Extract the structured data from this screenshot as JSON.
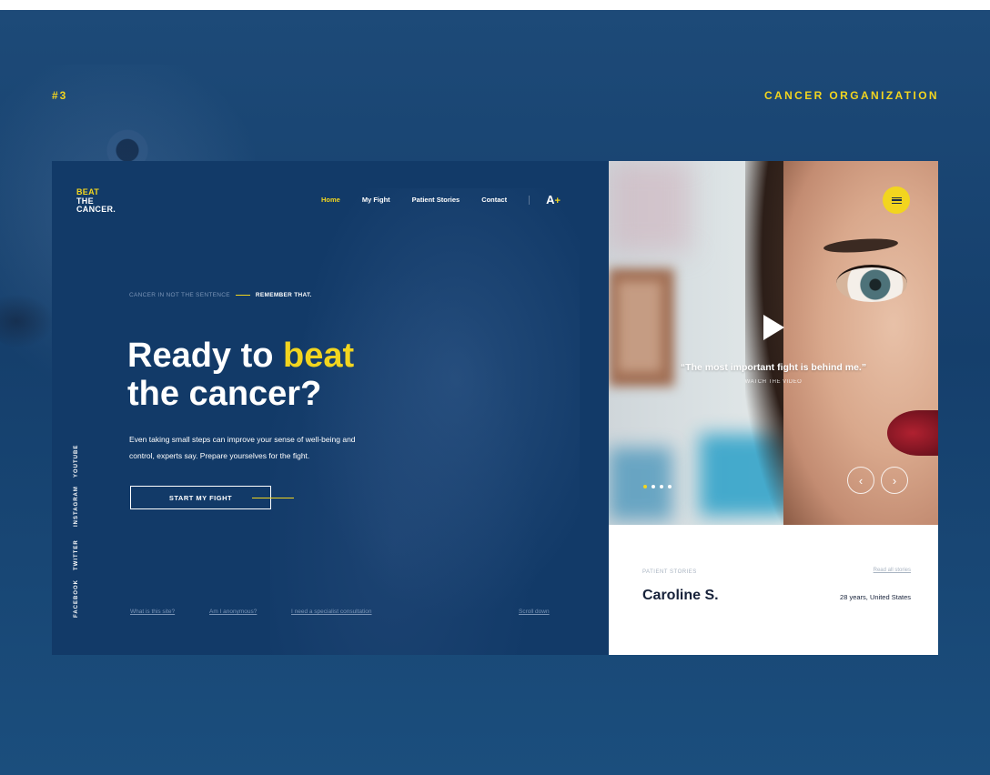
{
  "section": {
    "number": "#3",
    "title": "CANCER ORGANIZATION"
  },
  "logo": {
    "line1": "BEAT",
    "line2": "THE",
    "line3": "CANCER."
  },
  "nav": {
    "items": [
      {
        "label": "Home",
        "active": true
      },
      {
        "label": "My Fight",
        "active": false
      },
      {
        "label": "Patient Stories",
        "active": false
      },
      {
        "label": "Contact",
        "active": false
      }
    ],
    "font_size_letter": "A",
    "font_size_plus": "+"
  },
  "hero": {
    "tagline_muted": "CANCER IN NOT THE SENTENCE",
    "tagline_bold": "REMEMBER THAT.",
    "headline_part1": "Ready to",
    "headline_highlight": "beat",
    "headline_part2": "the cancer?",
    "lead": "Even taking small steps can improve your sense of well-being and control, experts say. Prepare yourselves for the fight.",
    "cta_label": "START MY FIGHT"
  },
  "social": [
    "YOUTUBE",
    "INSTAGRAM",
    "TWITTER",
    "FACEBOOK"
  ],
  "footer_links": [
    "What is this site?",
    "Am I anonymous?",
    "I need a specialist consultation",
    "Scroll down"
  ],
  "video": {
    "quote": "“The most important fight is behind me.”",
    "watch_label": "WATCH THE VIDEO",
    "slides": 4,
    "active_slide": 1,
    "prev_glyph": "‹",
    "next_glyph": "›"
  },
  "story": {
    "label": "PATIENT STORIES",
    "read_all": "Read all stories",
    "name": "Caroline S.",
    "meta": "28 years, United States"
  },
  "colors": {
    "accent": "#f2d51f",
    "navy": "#123a68",
    "background": "#1b4a78"
  },
  "icons": {
    "menu": "hamburger-menu-icon",
    "play": "play-icon",
    "prev": "chevron-left-icon",
    "next": "chevron-right-icon"
  }
}
